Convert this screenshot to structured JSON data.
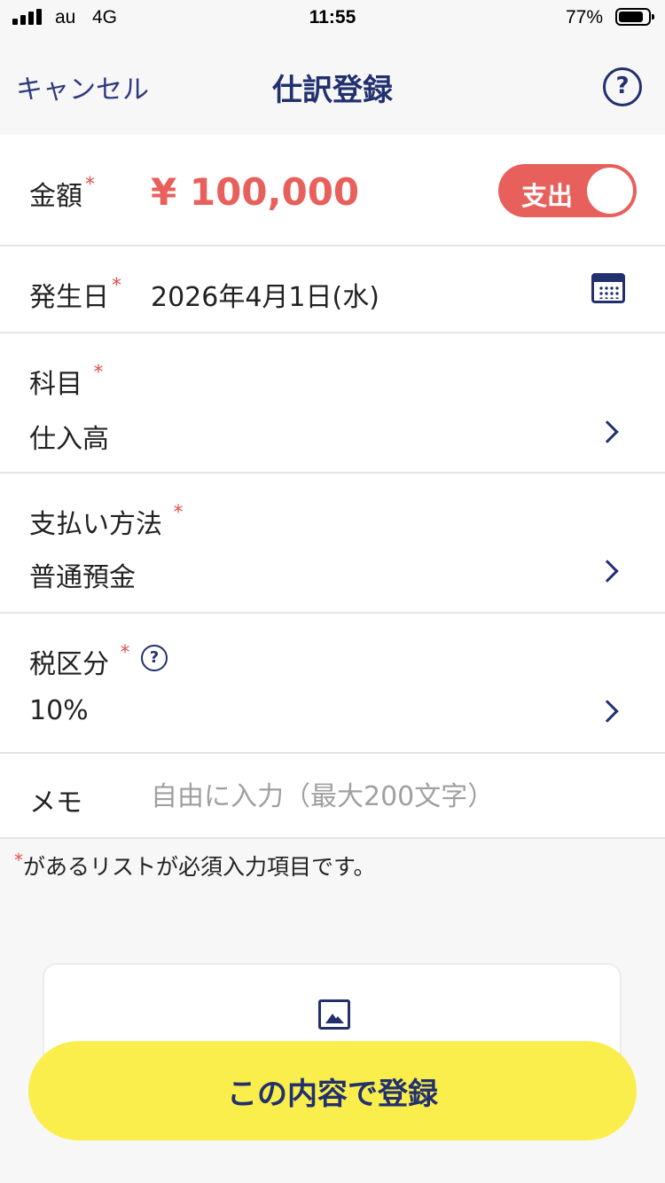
{
  "status_bar": {
    "carrier": "au",
    "network": "4G",
    "time": "11:55",
    "battery": "77%",
    "battery_level": 0.77
  },
  "nav": {
    "cancel_label": "キャンセル",
    "title": "仕訳登録",
    "help_glyph": "?"
  },
  "form": {
    "amount": {
      "label": "金額",
      "required_mark": "*",
      "value": "¥ 100,000",
      "type_toggle": "支出"
    },
    "date": {
      "label": "発生日",
      "required_mark": "*",
      "value": "2026年4月1日(水)"
    },
    "account": {
      "label": "科目",
      "required_mark": "*",
      "value": "仕入高"
    },
    "payment": {
      "label": "支払い方法",
      "required_mark": "*",
      "value": "普通預金"
    },
    "tax": {
      "label": "税区分",
      "required_mark": "*",
      "value": "10%",
      "help_glyph": "?"
    },
    "memo": {
      "label": "メモ",
      "placeholder": "自由に入力（最大200文字）",
      "value": ""
    }
  },
  "note": {
    "star": "*",
    "text": "があるリストが必須入力項目です。"
  },
  "submit_label": "この内容で登録",
  "colors": {
    "accent": "#22306e",
    "expense": "#e8605c",
    "submit_bg": "#f9ee4c",
    "required": "#e0504c"
  },
  "icons": [
    "calendar-icon",
    "chevron-right-icon",
    "help-icon",
    "image-icon"
  ]
}
